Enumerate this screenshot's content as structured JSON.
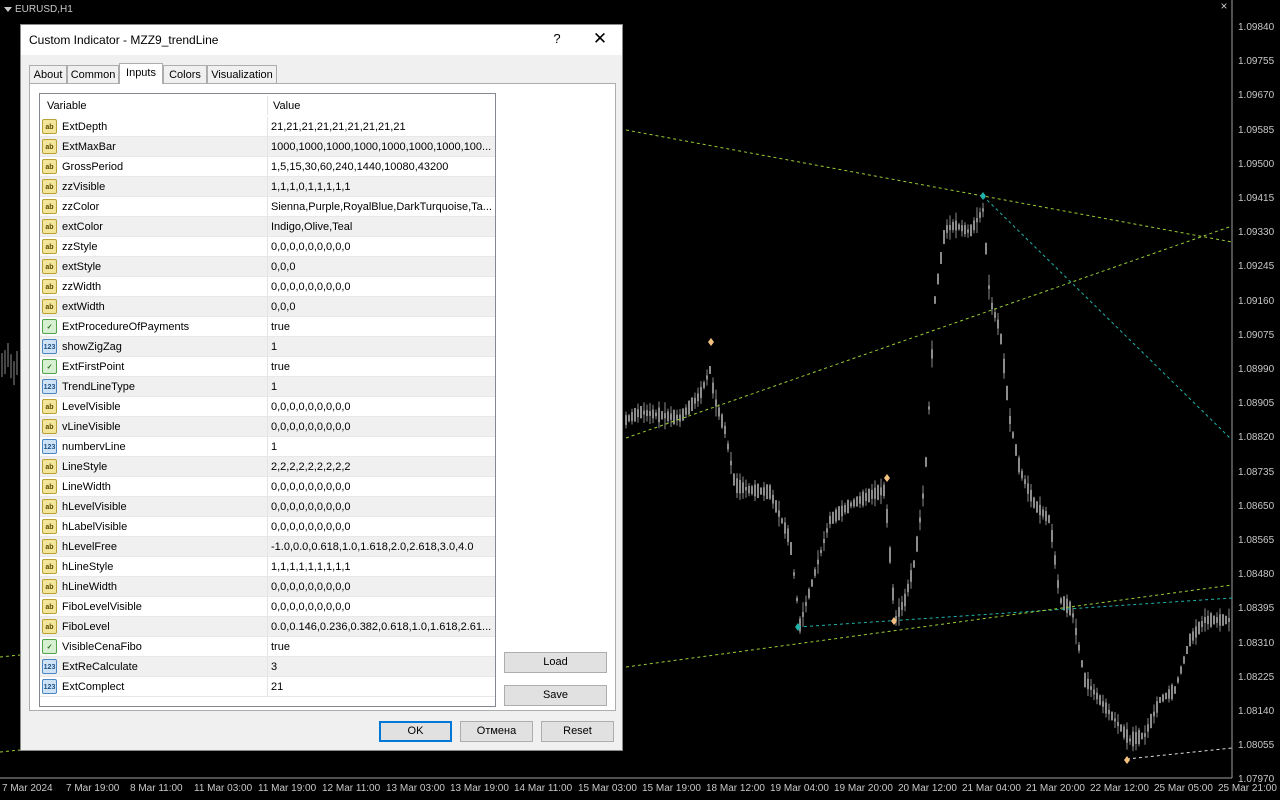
{
  "chart": {
    "symbol": "EURUSD,H1",
    "close_glyph": "×",
    "price_labels": [
      "1.09840",
      "1.09755",
      "1.09670",
      "1.09585",
      "1.09500",
      "1.09415",
      "1.09330",
      "1.09245",
      "1.09160",
      "1.09075",
      "1.08990",
      "1.08905",
      "1.08820",
      "1.08735",
      "1.08650",
      "1.08565",
      "1.08480",
      "1.08395",
      "1.08310",
      "1.08225",
      "1.08140",
      "1.08055",
      "1.07970"
    ],
    "time_labels": [
      "7 Mar 2024",
      "7 Mar 19:00",
      "8 Mar 11:00",
      "11 Mar 03:00",
      "11 Mar 19:00",
      "12 Mar 11:00",
      "13 Mar 03:00",
      "13 Mar 19:00",
      "14 Mar 11:00",
      "15 Mar 03:00",
      "15 Mar 19:00",
      "18 Mar 12:00",
      "19 Mar 04:00",
      "19 Mar 20:00",
      "20 Mar 12:00",
      "21 Mar 04:00",
      "21 Mar 20:00",
      "22 Mar 12:00",
      "25 Mar 05:00",
      "25 Mar 21:00"
    ],
    "colors": {
      "background": "#000000",
      "candle": "#8c8c8c",
      "teal": "#20b2aa",
      "olive": "#9acd32",
      "orange_marker": "#f4c080",
      "axis_text": "#c8c8c8"
    }
  },
  "dialog": {
    "title": "Custom Indicator - MZZ9_trendLine",
    "help": "?",
    "close": "✕",
    "tabs": [
      {
        "label": "About",
        "active": false
      },
      {
        "label": "Common",
        "active": false
      },
      {
        "label": "Inputs",
        "active": true
      },
      {
        "label": "Colors",
        "active": false
      },
      {
        "label": "Visualization",
        "active": false
      }
    ],
    "grid": {
      "col_variable": "Variable",
      "col_value": "Value",
      "rows": [
        {
          "type": "str",
          "icon": "ab",
          "name": "ExtDepth",
          "value": "21,21,21,21,21,21,21,21,21"
        },
        {
          "type": "str",
          "icon": "ab",
          "name": "ExtMaxBar",
          "value": "1000,1000,1000,1000,1000,1000,1000,100..."
        },
        {
          "type": "str",
          "icon": "ab",
          "name": "GrossPeriod",
          "value": "1,5,15,30,60,240,1440,10080,43200"
        },
        {
          "type": "str",
          "icon": "ab",
          "name": "zzVisible",
          "value": "1,1,1,0,1,1,1,1,1"
        },
        {
          "type": "str",
          "icon": "ab",
          "name": "zzColor",
          "value": "Sienna,Purple,RoyalBlue,DarkTurquoise,Ta..."
        },
        {
          "type": "str",
          "icon": "ab",
          "name": "extColor",
          "value": "Indigo,Olive,Teal"
        },
        {
          "type": "str",
          "icon": "ab",
          "name": "zzStyle",
          "value": "0,0,0,0,0,0,0,0,0"
        },
        {
          "type": "str",
          "icon": "ab",
          "name": "extStyle",
          "value": "0,0,0"
        },
        {
          "type": "str",
          "icon": "ab",
          "name": "zzWidth",
          "value": "0,0,0,0,0,0,0,0,0"
        },
        {
          "type": "str",
          "icon": "ab",
          "name": "extWidth",
          "value": "0,0,0"
        },
        {
          "type": "bool",
          "icon": "✓",
          "name": "ExtProcedureOfPayments",
          "value": "true"
        },
        {
          "type": "num",
          "icon": "123",
          "name": "showZigZag",
          "value": "1"
        },
        {
          "type": "bool",
          "icon": "✓",
          "name": "ExtFirstPoint",
          "value": "true"
        },
        {
          "type": "num",
          "icon": "123",
          "name": "TrendLineType",
          "value": "1"
        },
        {
          "type": "str",
          "icon": "ab",
          "name": "LevelVisible",
          "value": "0,0,0,0,0,0,0,0,0"
        },
        {
          "type": "str",
          "icon": "ab",
          "name": "vLineVisible",
          "value": "0,0,0,0,0,0,0,0,0"
        },
        {
          "type": "num",
          "icon": "123",
          "name": "numbervLine",
          "value": "1"
        },
        {
          "type": "str",
          "icon": "ab",
          "name": "LineStyle",
          "value": "2,2,2,2,2,2,2,2,2"
        },
        {
          "type": "str",
          "icon": "ab",
          "name": "LineWidth",
          "value": "0,0,0,0,0,0,0,0,0"
        },
        {
          "type": "str",
          "icon": "ab",
          "name": "hLevelVisible",
          "value": "0,0,0,0,0,0,0,0,0"
        },
        {
          "type": "str",
          "icon": "ab",
          "name": "hLabelVisible",
          "value": "0,0,0,0,0,0,0,0,0"
        },
        {
          "type": "str",
          "icon": "ab",
          "name": "hLevelFree",
          "value": "-1.0,0.0,0.618,1.0,1.618,2.0,2.618,3.0,4.0"
        },
        {
          "type": "str",
          "icon": "ab",
          "name": "hLineStyle",
          "value": "1,1,1,1,1,1,1,1,1"
        },
        {
          "type": "str",
          "icon": "ab",
          "name": "hLineWidth",
          "value": "0,0,0,0,0,0,0,0,0"
        },
        {
          "type": "str",
          "icon": "ab",
          "name": "FiboLevelVisible",
          "value": "0,0,0,0,0,0,0,0,0"
        },
        {
          "type": "str",
          "icon": "ab",
          "name": "FiboLevel",
          "value": "0.0,0.146,0.236,0.382,0.618,1.0,1.618,2.61..."
        },
        {
          "type": "bool",
          "icon": "✓",
          "name": "VisibleCenaFibo",
          "value": "true"
        },
        {
          "type": "num",
          "icon": "123",
          "name": "ExtReCalculate",
          "value": "3"
        },
        {
          "type": "num",
          "icon": "123",
          "name": "ExtComplect",
          "value": "21"
        }
      ]
    },
    "buttons": {
      "load": "Load",
      "save": "Save",
      "ok": "OK",
      "cancel": "Отмена",
      "reset": "Reset"
    }
  }
}
